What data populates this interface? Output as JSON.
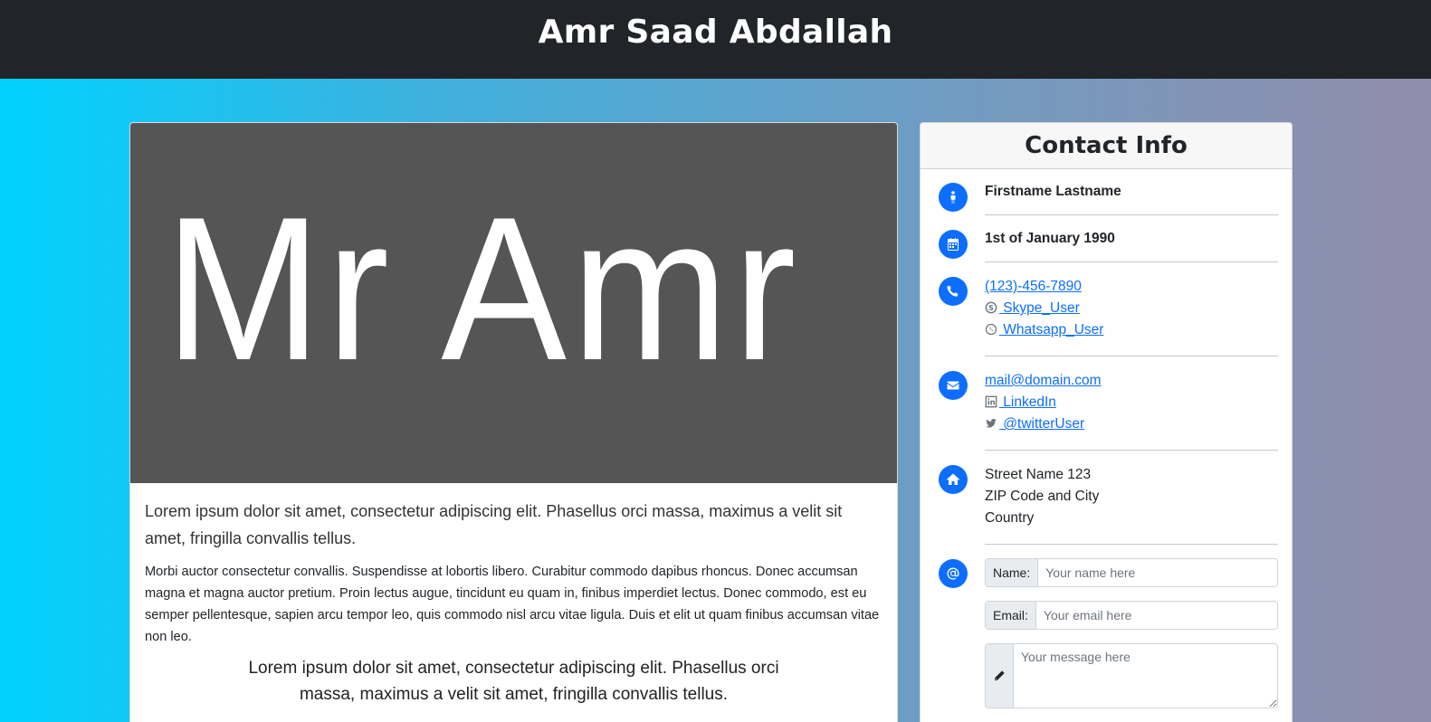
{
  "header": {
    "title": "Amr Saad Abdallah"
  },
  "main": {
    "hero_text": "Mr Amr",
    "lead": "Lorem ipsum dolor sit amet, consectetur adipiscing elit. Phasellus orci massa, maximus a velit sit amet, fringilla convallis tellus.",
    "paragraph": "Morbi auctor consectetur convallis. Suspendisse at lobortis libero. Curabitur commodo dapibus rhoncus. Donec accumsan magna et magna auctor pretium. Proin lectus augue, tincidunt eu quam in, finibus imperdiet lectus. Donec commodo, est eu semper pellentesque, sapien arcu tempor leo, quis commodo nisl arcu vitae ligula. Duis et elit ut quam finibus accumsan vitae non leo.",
    "quote": "Lorem ipsum dolor sit amet, consectetur adipiscing elit. Phasellus orci massa, maximus a velit sit amet, fringilla convallis tellus."
  },
  "contact": {
    "title": "Contact Info",
    "name": "Firstname Lastname",
    "birthday": "1st of January 1990",
    "phone": "(123)-456-7890",
    "skype": " Skype_User",
    "whatsapp": " Whatsapp_User",
    "email": "mail@domain.com",
    "linkedin": " LinkedIn",
    "twitter": " @twitterUser",
    "address_line1": "Street Name 123",
    "address_line2": "ZIP Code and City",
    "address_line3": "Country",
    "form": {
      "name_label": "Name:",
      "name_placeholder": "Your name here",
      "email_label": "Email:",
      "email_placeholder": "Your email here",
      "message_placeholder": "Your message here"
    }
  },
  "colors": {
    "accent": "#0d6efd",
    "topbar": "#212529",
    "hero_bg": "#555555"
  }
}
